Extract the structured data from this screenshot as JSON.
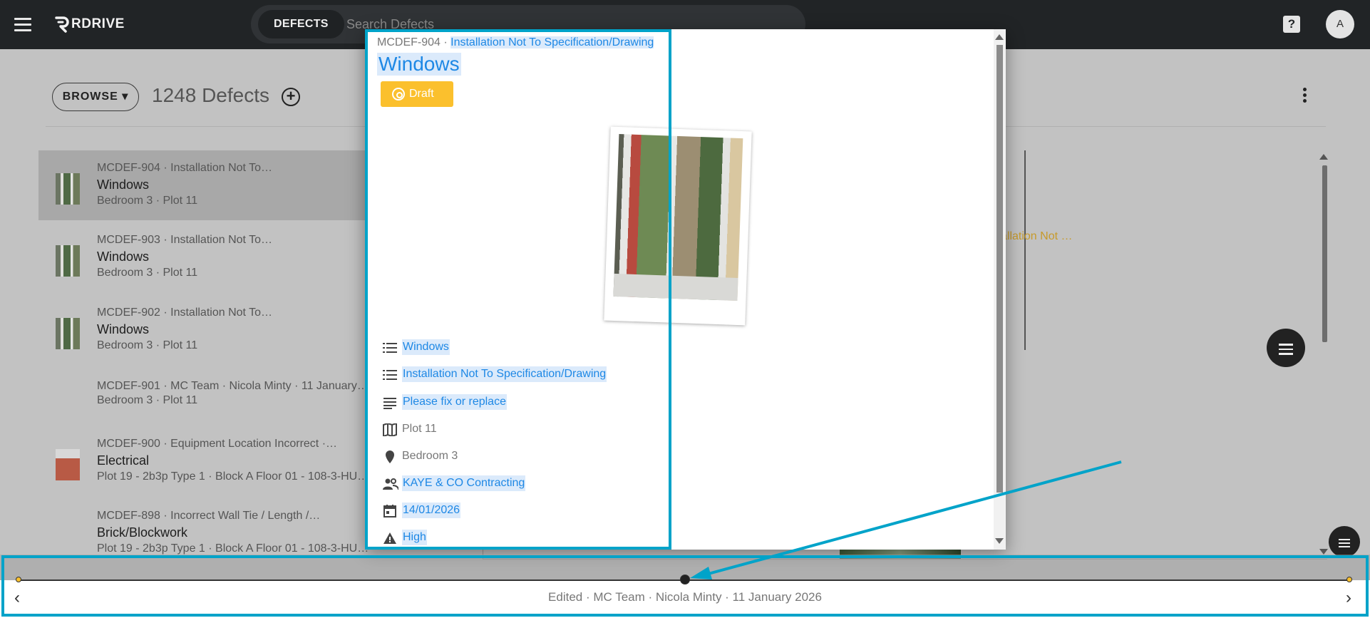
{
  "app": {
    "brand": "RDRIVE"
  },
  "search": {
    "chip_label": "DEFECTS",
    "placeholder": "Search Defects"
  },
  "user": {
    "avatar_initial": "A"
  },
  "help": {
    "label": "?"
  },
  "header": {
    "browse_label": "BROWSE",
    "count_label": "1248 Defects"
  },
  "list": {
    "items": [
      {
        "ref": "MCDEF-904 · Installation Not To…",
        "title": "Windows",
        "sub": "Bedroom 3 · Plot 11",
        "thumb": "window"
      },
      {
        "ref": "MCDEF-903 · Installation Not To…",
        "title": "Windows",
        "sub": "Bedroom 3 · Plot 11",
        "thumb": "window"
      },
      {
        "ref": "MCDEF-902 · Installation Not To…",
        "title": "Windows",
        "sub": "Bedroom 3 · Plot 11",
        "thumb": "window"
      },
      {
        "ref": "MCDEF-901 · MC Team · Nicola Minty · 11 January…",
        "title": "",
        "sub": "Bedroom 3 · Plot 11",
        "thumb": ""
      },
      {
        "ref": "MCDEF-900 · Equipment Location Incorrect ·…",
        "title": "Electrical",
        "sub": "Plot 19 - 2b3p Type 1 · Block A Floor 01 - 108-3-HU…",
        "thumb": "electrical"
      },
      {
        "ref": "MCDEF-898 · Incorrect Wall Tie / Length /…",
        "title": "Brick/Blockwork",
        "sub": "Plot 19 - 2b3p Type 1 · Block A Floor 01 - 108-3-HU…",
        "thumb": ""
      }
    ]
  },
  "background": {
    "amber_text": "allation Not …"
  },
  "dialog": {
    "ref_id": "MCDEF-904 ·",
    "ref_reason": "Installation Not To Specification/Drawing",
    "title": "Windows",
    "status": "Draft",
    "fields": [
      {
        "icon": "list-icon",
        "text": "Windows",
        "style": "link"
      },
      {
        "icon": "list-icon",
        "text": "Installation Not To Specification/Drawing",
        "style": "link"
      },
      {
        "icon": "notes-icon",
        "text": "Please fix or replace",
        "style": "link"
      },
      {
        "icon": "map-icon",
        "text": "Plot 11",
        "style": "plain"
      },
      {
        "icon": "location-pin-icon",
        "text": "Bedroom 3",
        "style": "plain"
      },
      {
        "icon": "people-icon",
        "text": "KAYE & CO Contracting",
        "style": "link"
      },
      {
        "icon": "calendar-icon",
        "text": "14/01/2026",
        "style": "link"
      },
      {
        "icon": "warning-icon",
        "text": "High",
        "style": "link"
      }
    ]
  },
  "timeline": {
    "caption": "Edited · MC Team · Nicola Minty · 11 January 2026"
  },
  "colors": {
    "accent": "#1e88e5",
    "draft": "#fbc02d",
    "highlight": "#00a3c9",
    "topbar": "#212426"
  }
}
